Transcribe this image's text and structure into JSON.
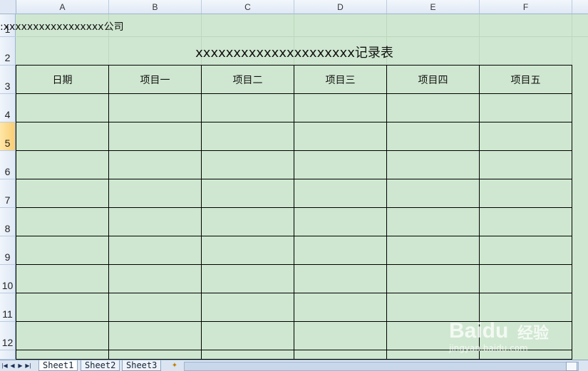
{
  "columns": [
    "A",
    "B",
    "C",
    "D",
    "E",
    "F"
  ],
  "rows": [
    "1",
    "2",
    "3",
    "4",
    "5",
    "6",
    "7",
    "8",
    "9",
    "10",
    "11",
    "12"
  ],
  "cells": {
    "company": ":xxxxxxxxxxxxxxxxx公司",
    "title": "xxxxxxxxxxxxxxxxxxxxx记录表"
  },
  "table": {
    "headers": [
      "日期",
      "项目一",
      "项目二",
      "项目三",
      "项目四",
      "项目五"
    ]
  },
  "sheets": [
    "Sheet1",
    "Sheet2",
    "Sheet3"
  ],
  "watermark": {
    "brand": "Baidu",
    "cn": "经验",
    "url": "jingyan.baidu.com"
  },
  "colors": {
    "cell_background": "#cfe7d0",
    "header_background": "#dfe8f4",
    "active_row_header": "#f9cd72"
  }
}
